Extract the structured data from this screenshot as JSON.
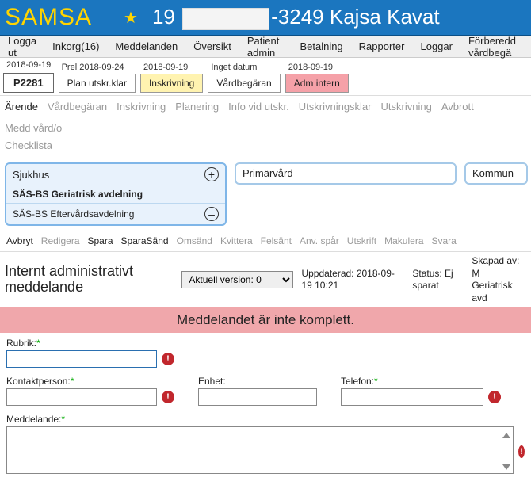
{
  "header": {
    "app": "SAMSA",
    "patient_prefix": "19",
    "patient_suffix": "-3249 Kajsa Kavat"
  },
  "menu": [
    "Logga ut",
    "Inkorg(16)",
    "Meddelanden",
    "Översikt",
    "Patient admin",
    "Betalning",
    "Rapporter",
    "Loggar",
    "Förberedd vårdbegä"
  ],
  "plan": {
    "date1": "2018-09-19",
    "code": "P2281",
    "prel_lbl": "Prel 2018-09-24",
    "plan_clear": "Plan utskr.klar",
    "inskr_lbl": "2018-09-19",
    "inskr": "Inskrivning",
    "vard_lbl": "Inget datum",
    "vard": "Vårdbegäran",
    "adm_lbl": "2018-09-19",
    "adm": "Adm intern"
  },
  "subtabs": [
    "Ärende",
    "Vårdbegäran",
    "Inskrivning",
    "Planering",
    "Info vid utskr.",
    "Utskrivningsklar",
    "Utskrivning",
    "Avbrott",
    "Medd vård/o"
  ],
  "subtabs_active": 0,
  "checklista": "Checklista",
  "org": {
    "sjukhus": "Sjukhus",
    "r1": "SÄS-BS Geriatrisk avdelning",
    "r2": "SÄS-BS Eftervårdsavdelning",
    "prim": "Primärvård",
    "komm": "Kommun"
  },
  "actions": [
    "Avbryt",
    "Redigera",
    "Spara",
    "SparaSänd",
    "Omsänd",
    "Kvittera",
    "Felsänt",
    "Anv. spår",
    "Utskrift",
    "Makulera",
    "Svara"
  ],
  "actions_active": [
    0,
    2,
    3
  ],
  "form_head": {
    "title": "Internt administrativt meddelande",
    "version": "Aktuell version: 0",
    "upd": "Uppdaterad: 2018-09-19 10:21",
    "status": "Status: Ej sparat",
    "skapad": "Skapad av: M\nGeriatrisk avd"
  },
  "warning": "Meddelandet är inte komplett.",
  "form": {
    "rubrik": "Rubrik:",
    "kontakt": "Kontaktperson:",
    "enhet": "Enhet:",
    "telefon": "Telefon:",
    "medd": "Meddelande:"
  }
}
